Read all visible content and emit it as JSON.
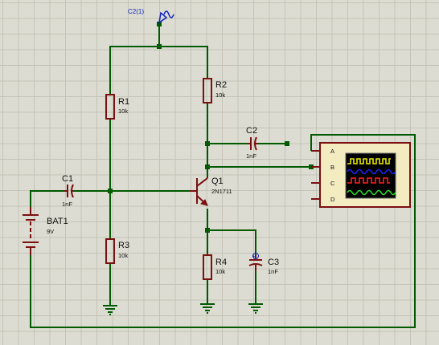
{
  "probe": {
    "label": "C2(1)"
  },
  "components": {
    "r1": {
      "ref": "R1",
      "value": "10k"
    },
    "r2": {
      "ref": "R2",
      "value": "10k"
    },
    "r3": {
      "ref": "R3",
      "value": "10k"
    },
    "r4": {
      "ref": "R4",
      "value": "10k"
    },
    "c1": {
      "ref": "C1",
      "value": "1nF"
    },
    "c2": {
      "ref": "C2",
      "value": "1nF"
    },
    "c3": {
      "ref": "C3",
      "value": "1nF"
    },
    "q1": {
      "ref": "Q1",
      "value": "2N1711"
    },
    "bat1": {
      "ref": "BAT1",
      "value": "9V"
    }
  },
  "oscilloscope": {
    "channels": [
      "A",
      "B",
      "C",
      "D"
    ],
    "trace_colors": [
      "#e8e800",
      "#2020ff",
      "#ff2020",
      "#20e020"
    ]
  },
  "colors": {
    "wire": "#005a00",
    "component": "#7a1010",
    "probe": "#1020c0",
    "background": "#dcdcd2"
  }
}
